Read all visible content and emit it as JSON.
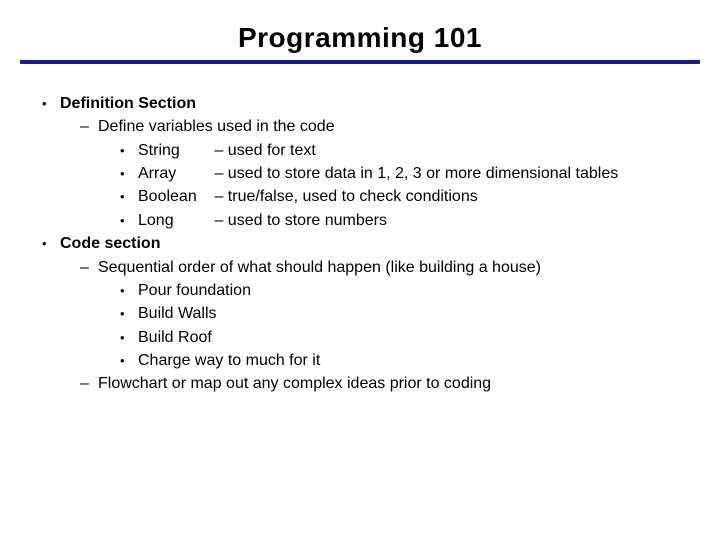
{
  "title": "Programming 101",
  "sections": [
    {
      "heading": "Definition Section",
      "subitems": [
        {
          "text": "Define variables used in the code",
          "types": [
            {
              "name": "String",
              "desc": "– used for text"
            },
            {
              "name": "Array",
              "desc": "– used to store data in 1, 2, 3 or more dimensional tables"
            },
            {
              "name": "Boolean",
              "desc": "– true/false, used to check conditions"
            },
            {
              "name": "Long",
              "desc": "– used to store numbers"
            }
          ]
        }
      ]
    },
    {
      "heading": "Code section",
      "subitems": [
        {
          "text": "Sequential order of what should happen (like building a house)",
          "steps": [
            "Pour foundation",
            "Build Walls",
            "Build Roof",
            "Charge way to much for it"
          ]
        },
        {
          "text": "Flowchart or map out any complex ideas prior to coding"
        }
      ]
    }
  ]
}
